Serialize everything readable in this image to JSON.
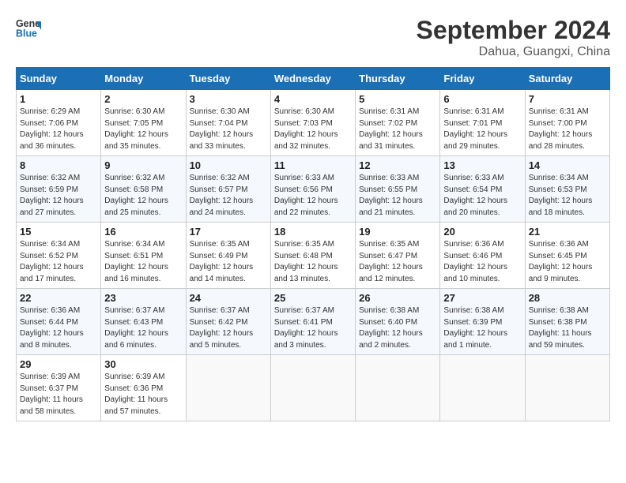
{
  "header": {
    "logo_line1": "General",
    "logo_line2": "Blue",
    "title": "September 2024",
    "subtitle": "Dahua, Guangxi, China"
  },
  "days_of_week": [
    "Sunday",
    "Monday",
    "Tuesday",
    "Wednesday",
    "Thursday",
    "Friday",
    "Saturday"
  ],
  "weeks": [
    [
      {
        "num": "1",
        "sr": "6:29 AM",
        "ss": "7:06 PM",
        "dl": "12 hours and 36 minutes."
      },
      {
        "num": "2",
        "sr": "6:30 AM",
        "ss": "7:05 PM",
        "dl": "12 hours and 35 minutes."
      },
      {
        "num": "3",
        "sr": "6:30 AM",
        "ss": "7:04 PM",
        "dl": "12 hours and 33 minutes."
      },
      {
        "num": "4",
        "sr": "6:30 AM",
        "ss": "7:03 PM",
        "dl": "12 hours and 32 minutes."
      },
      {
        "num": "5",
        "sr": "6:31 AM",
        "ss": "7:02 PM",
        "dl": "12 hours and 31 minutes."
      },
      {
        "num": "6",
        "sr": "6:31 AM",
        "ss": "7:01 PM",
        "dl": "12 hours and 29 minutes."
      },
      {
        "num": "7",
        "sr": "6:31 AM",
        "ss": "7:00 PM",
        "dl": "12 hours and 28 minutes."
      }
    ],
    [
      {
        "num": "8",
        "sr": "6:32 AM",
        "ss": "6:59 PM",
        "dl": "12 hours and 27 minutes."
      },
      {
        "num": "9",
        "sr": "6:32 AM",
        "ss": "6:58 PM",
        "dl": "12 hours and 25 minutes."
      },
      {
        "num": "10",
        "sr": "6:32 AM",
        "ss": "6:57 PM",
        "dl": "12 hours and 24 minutes."
      },
      {
        "num": "11",
        "sr": "6:33 AM",
        "ss": "6:56 PM",
        "dl": "12 hours and 22 minutes."
      },
      {
        "num": "12",
        "sr": "6:33 AM",
        "ss": "6:55 PM",
        "dl": "12 hours and 21 minutes."
      },
      {
        "num": "13",
        "sr": "6:33 AM",
        "ss": "6:54 PM",
        "dl": "12 hours and 20 minutes."
      },
      {
        "num": "14",
        "sr": "6:34 AM",
        "ss": "6:53 PM",
        "dl": "12 hours and 18 minutes."
      }
    ],
    [
      {
        "num": "15",
        "sr": "6:34 AM",
        "ss": "6:52 PM",
        "dl": "12 hours and 17 minutes."
      },
      {
        "num": "16",
        "sr": "6:34 AM",
        "ss": "6:51 PM",
        "dl": "12 hours and 16 minutes."
      },
      {
        "num": "17",
        "sr": "6:35 AM",
        "ss": "6:49 PM",
        "dl": "12 hours and 14 minutes."
      },
      {
        "num": "18",
        "sr": "6:35 AM",
        "ss": "6:48 PM",
        "dl": "12 hours and 13 minutes."
      },
      {
        "num": "19",
        "sr": "6:35 AM",
        "ss": "6:47 PM",
        "dl": "12 hours and 12 minutes."
      },
      {
        "num": "20",
        "sr": "6:36 AM",
        "ss": "6:46 PM",
        "dl": "12 hours and 10 minutes."
      },
      {
        "num": "21",
        "sr": "6:36 AM",
        "ss": "6:45 PM",
        "dl": "12 hours and 9 minutes."
      }
    ],
    [
      {
        "num": "22",
        "sr": "6:36 AM",
        "ss": "6:44 PM",
        "dl": "12 hours and 8 minutes."
      },
      {
        "num": "23",
        "sr": "6:37 AM",
        "ss": "6:43 PM",
        "dl": "12 hours and 6 minutes."
      },
      {
        "num": "24",
        "sr": "6:37 AM",
        "ss": "6:42 PM",
        "dl": "12 hours and 5 minutes."
      },
      {
        "num": "25",
        "sr": "6:37 AM",
        "ss": "6:41 PM",
        "dl": "12 hours and 3 minutes."
      },
      {
        "num": "26",
        "sr": "6:38 AM",
        "ss": "6:40 PM",
        "dl": "12 hours and 2 minutes."
      },
      {
        "num": "27",
        "sr": "6:38 AM",
        "ss": "6:39 PM",
        "dl": "12 hours and 1 minute."
      },
      {
        "num": "28",
        "sr": "6:38 AM",
        "ss": "6:38 PM",
        "dl": "11 hours and 59 minutes."
      }
    ],
    [
      {
        "num": "29",
        "sr": "6:39 AM",
        "ss": "6:37 PM",
        "dl": "11 hours and 58 minutes."
      },
      {
        "num": "30",
        "sr": "6:39 AM",
        "ss": "6:36 PM",
        "dl": "11 hours and 57 minutes."
      },
      null,
      null,
      null,
      null,
      null
    ]
  ]
}
